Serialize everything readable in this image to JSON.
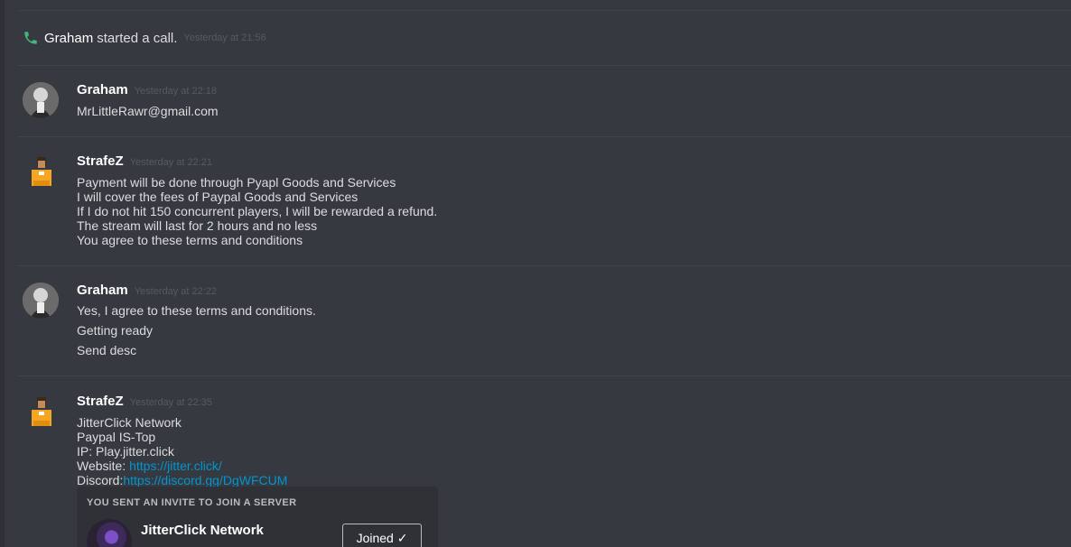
{
  "system": {
    "author": "Graham",
    "text": "started a call.",
    "timestamp": "Yesterday at 21:56",
    "icon": "phone-icon"
  },
  "messages": [
    {
      "author": "Graham",
      "timestamp": "Yesterday at 22:18",
      "avatar": "avatar-graham",
      "lines": [
        "MrLittleRawr@gmail.com"
      ]
    },
    {
      "author": "StrafeZ",
      "timestamp": "Yesterday at 22:21",
      "avatar": "avatar-strafez",
      "lines": [
        "Payment will be done through Pyapl Goods and Services",
        "I will cover the fees of Paypal Goods and Services",
        "If I do not hit 150 concurrent players, I will be rewarded a refund.",
        "The stream will last for 2 hours and no less",
        "You agree to these terms and conditions"
      ]
    },
    {
      "author": "Graham",
      "timestamp": "Yesterday at 22:22",
      "avatar": "avatar-graham",
      "lines": [
        "Yes, I agree to these terms and conditions.",
        "Getting ready",
        "Send desc"
      ]
    },
    {
      "author": "StrafeZ",
      "timestamp": "Yesterday at 22:35",
      "avatar": "avatar-strafez",
      "lines": [
        "JitterClick Network",
        "Paypal IS-Top",
        "IP: Play.jitter.click"
      ],
      "website_label": "Website: ",
      "website_link": "https://jitter.click/",
      "discord_label": "Discord:",
      "discord_link": "https://discord.gg/DgWFCUM"
    }
  ],
  "invite": {
    "header": "YOU SENT AN INVITE TO JOIN A SERVER",
    "server_name": "JitterClick Network",
    "button_label": "Joined ✓"
  },
  "colors": {
    "background": "#36393f",
    "link": "#0096cf",
    "call_icon": "#43b581"
  }
}
